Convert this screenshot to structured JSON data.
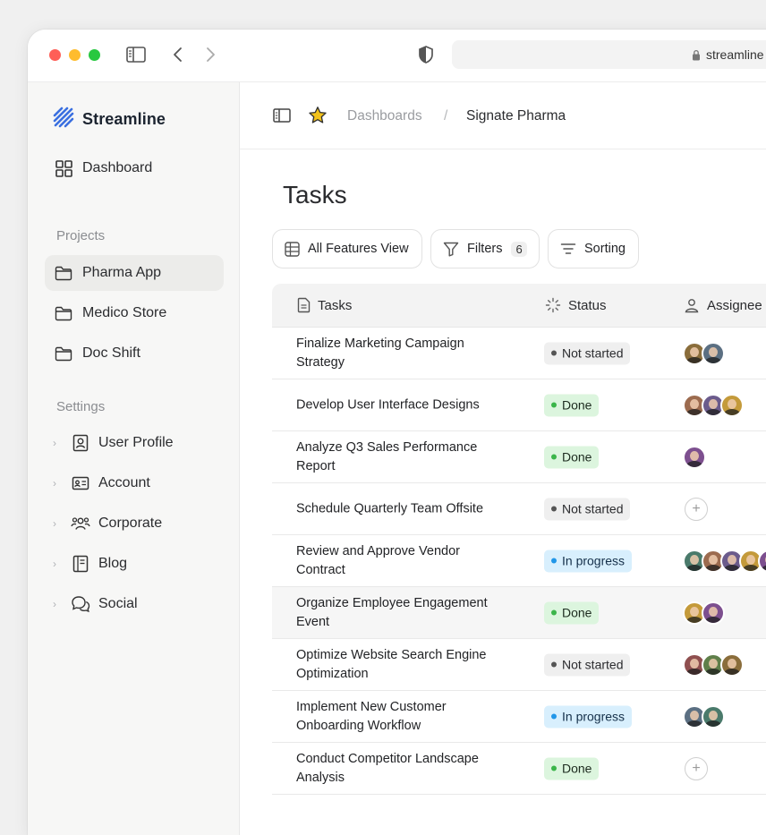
{
  "browser": {
    "url": "streamline"
  },
  "app": {
    "name": "Streamline"
  },
  "sidebar": {
    "dashboard_label": "Dashboard",
    "projects_label": "Projects",
    "projects": [
      {
        "label": "Pharma App",
        "active": true
      },
      {
        "label": "Medico Store",
        "active": false
      },
      {
        "label": "Doc Shift",
        "active": false
      }
    ],
    "settings_label": "Settings",
    "settings": [
      {
        "label": "User Profile",
        "icon": "user-profile-icon"
      },
      {
        "label": "Account",
        "icon": "id-card-icon"
      },
      {
        "label": "Corporate",
        "icon": "team-icon"
      },
      {
        "label": "Blog",
        "icon": "document-icon"
      },
      {
        "label": "Social",
        "icon": "chat-icon"
      }
    ]
  },
  "breadcrumb": {
    "parent": "Dashboards",
    "separator": "/",
    "current": "Signate Pharma"
  },
  "page": {
    "title": "Tasks"
  },
  "toolbar": {
    "view_label": "All Features View",
    "filters_label": "Filters",
    "filters_count": "6",
    "sorting_label": "Sorting"
  },
  "table": {
    "headers": {
      "tasks": "Tasks",
      "status": "Status",
      "assignee": "Assignee"
    },
    "rows": [
      {
        "task": "Finalize Marketing Campaign Strategy",
        "status": "Not started",
        "status_type": "ns",
        "assignees": 2,
        "highlighted": false
      },
      {
        "task": "Develop User Interface Designs",
        "status": "Done",
        "status_type": "done",
        "assignees": 3,
        "highlighted": false
      },
      {
        "task": "Analyze Q3 Sales Performance Report",
        "status": "Done",
        "status_type": "done",
        "assignees": 1,
        "highlighted": false
      },
      {
        "task": "Schedule Quarterly Team Offsite",
        "status": "Not started",
        "status_type": "ns",
        "assignees": 0,
        "highlighted": false
      },
      {
        "task": "Review and Approve Vendor Contract",
        "status": "In progress",
        "status_type": "ip",
        "assignees": 5,
        "highlighted": false
      },
      {
        "task": "Organize Employee Engagement Event",
        "status": "Done",
        "status_type": "done",
        "assignees": 2,
        "highlighted": true
      },
      {
        "task": "Optimize Website Search Engine Optimization",
        "status": "Not started",
        "status_type": "ns",
        "assignees": 3,
        "highlighted": false
      },
      {
        "task": "Implement New Customer Onboarding Workflow",
        "status": "In progress",
        "status_type": "ip",
        "assignees": 2,
        "highlighted": false
      },
      {
        "task": "Conduct Competitor Landscape Analysis",
        "status": "Done",
        "status_type": "done",
        "assignees": 0,
        "highlighted": false
      }
    ]
  },
  "colors": {
    "accent": "#3a6fe0",
    "done": "#3bb54a",
    "in_progress": "#2196e8",
    "not_started": "#555555",
    "star": "#f2c21a"
  }
}
